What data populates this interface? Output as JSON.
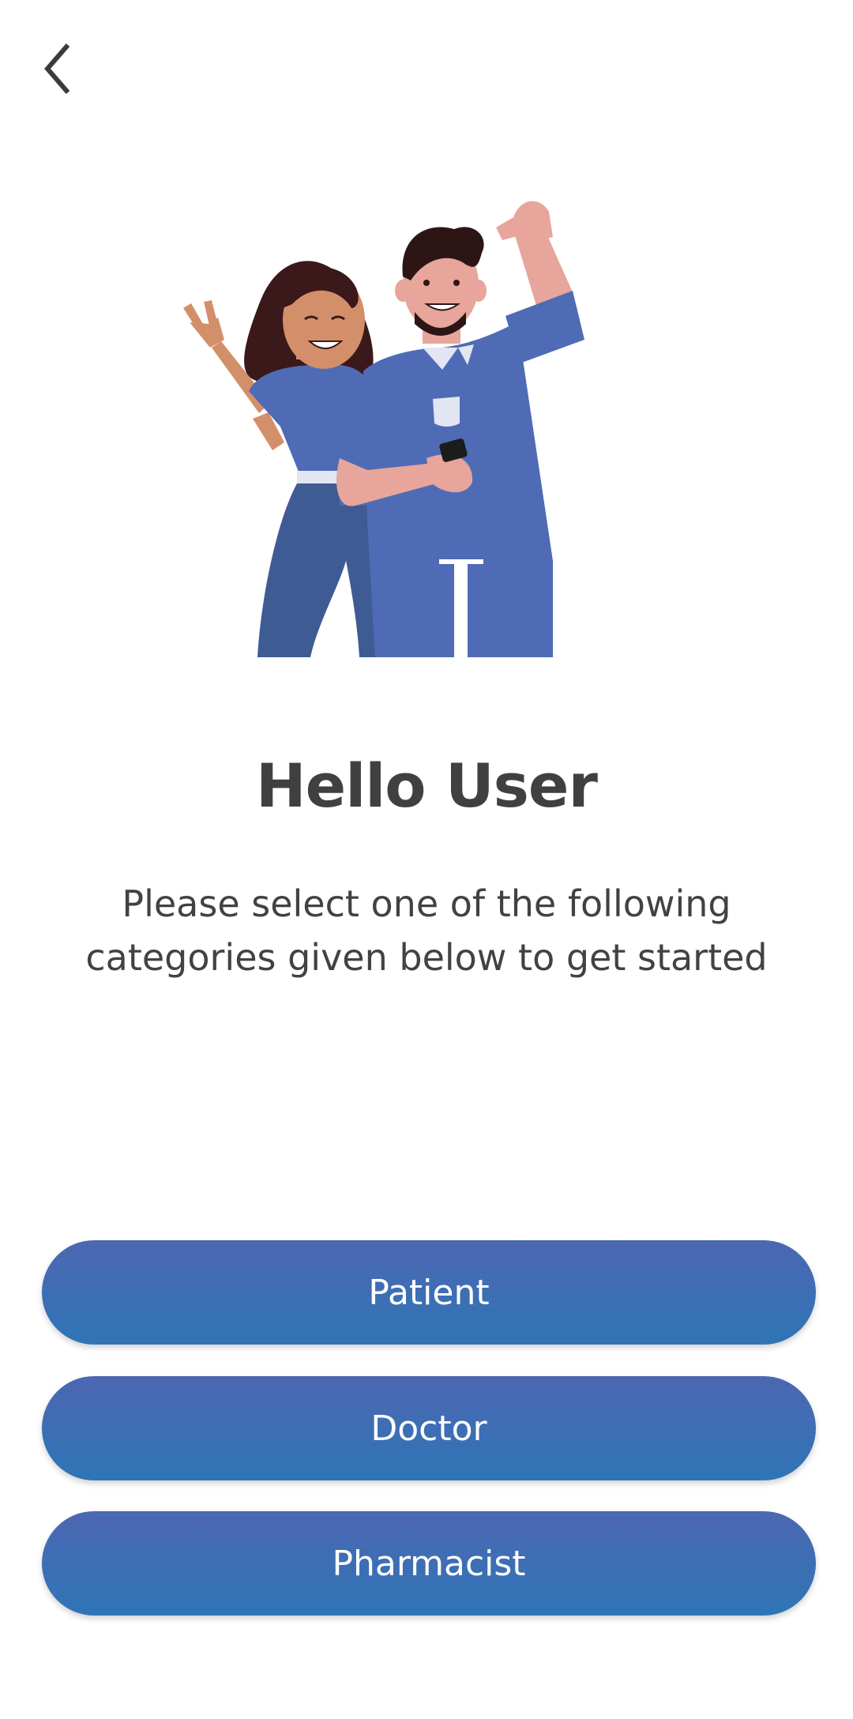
{
  "header": {
    "back_icon": "chevron-left-icon"
  },
  "hero": {
    "illustration": "two-healthcare-workers-waving-illustration"
  },
  "main": {
    "title": "Hello User",
    "subtitle": "Please select one of the following categories given below to get started"
  },
  "buttons": {
    "patient": "Patient",
    "doctor": "Doctor",
    "pharmacist": "Pharmacist"
  },
  "colors": {
    "button_top": "#4c67b2",
    "button_bottom": "#2f75b6",
    "title_text": "#404040",
    "body_text": "#424242"
  }
}
